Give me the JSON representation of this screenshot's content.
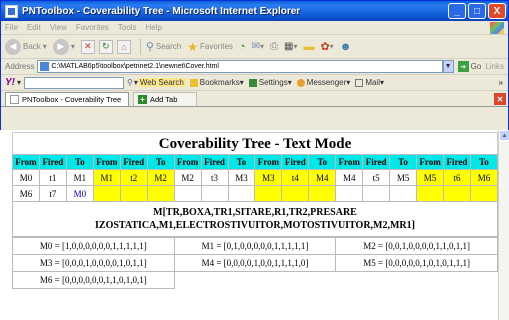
{
  "window": {
    "title": "PNToolbox - Coverability Tree - Microsoft Internet Explorer",
    "controls": {
      "minimize": "_",
      "maximize": "□",
      "close": "X"
    }
  },
  "menu": [
    "File",
    "Edit",
    "View",
    "Favorites",
    "Tools",
    "Help"
  ],
  "toolbar": {
    "back": "Back",
    "search": "Search",
    "favorites": "Favorites"
  },
  "address": {
    "label": "Address",
    "value": "C:\\MATLAB6p5\\toolbox\\petrinet2.1\\newnet\\Cover.html",
    "go": "Go",
    "links": "Links"
  },
  "yahoo": {
    "logo": "Y!",
    "web_search": "Web Search",
    "bookmarks": "Bookmarks",
    "settings": "Settings",
    "messenger": "Messenger",
    "mail": "Mail"
  },
  "tabs": {
    "active": "PNToolbox - Coverability Tree",
    "add": "Add Tab"
  },
  "colors": {
    "header_cyan": "#00e8e8",
    "marking_yellow": "#ffff00",
    "new_node_blue": "#0000cc"
  },
  "document": {
    "title": "Coverability Tree - Text Mode",
    "header": [
      "From",
      "Fired",
      "To",
      "From",
      "Fired",
      "To",
      "From",
      "Fired",
      "To",
      "From",
      "Fired",
      "To",
      "From",
      "Fired",
      "To",
      "From",
      "Fired",
      "To"
    ],
    "row1": [
      "M0",
      "t1",
      "M1",
      "M1",
      "t2",
      "M2",
      "M2",
      "t3",
      "M3",
      "M3",
      "t4",
      "M4",
      "M4",
      "t5",
      "M5",
      "M5",
      "t6",
      "M6"
    ],
    "row2": [
      "M6",
      "t7",
      "M0"
    ],
    "notation": "M[TR,BOXA,TR1,SITARE,R1,TR2,PRESARE IZOSTATICA,M1,ELECTROSTIVUITOR,MOTOSTIVUITOR,M2,MR1]",
    "markings": [
      [
        "M0 = [1,0,0,0,0,0,0,1,1,1,1,1]",
        "M1 = [0,1,0,0,0,0,0,1,1,1,1,1]",
        "M2 = [0,0,1,0,0,0,0,1,1,0,1,1]"
      ],
      [
        "M3 = [0,0,0,1,0,0,0,0,1,0,1,1]",
        "M4 = [0,0,0,0,1,0,0,1,1,1,1,0]",
        "M5 = [0,0,0,0,0,1,0,1,0,1,1,1]"
      ],
      [
        "M6 = [0,0,0,0,0,0,1,1,0,1,0,1]"
      ]
    ]
  }
}
